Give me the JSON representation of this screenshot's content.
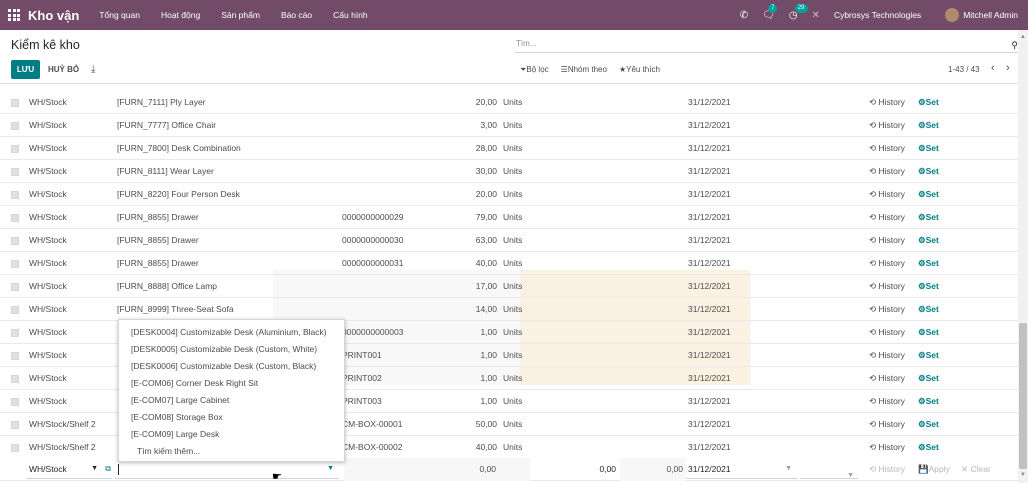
{
  "navbar": {
    "brand": "Kho vận",
    "menus": [
      "Tổng quan",
      "Hoạt động",
      "Sản phẩm",
      "Báo cáo",
      "Cấu hình"
    ],
    "chat_badge": "7",
    "activity_badge": "29",
    "company": "Cybrosys Technologies",
    "user": "Mitchell Admin"
  },
  "control": {
    "title": "Kiểm kê kho",
    "save_label": "LƯU",
    "discard_label": "HUỶ BỎ",
    "search_placeholder": "Tìm...",
    "filter_label": "Bộ lọc",
    "groupby_label": "Nhóm theo",
    "favorites_label": "Yêu thích",
    "pager": "1-43 / 43"
  },
  "rows": [
    {
      "location": "WH/Stock",
      "product": "[FURN_7111] Ply Layer",
      "lot": "",
      "qty": "20,00",
      "uom": "Units",
      "date": "31/12/2021",
      "history": "History",
      "set": "Set"
    },
    {
      "location": "WH/Stock",
      "product": "[FURN_7777] Office Chair",
      "lot": "",
      "qty": "3,00",
      "uom": "Units",
      "date": "31/12/2021",
      "history": "History",
      "set": "Set"
    },
    {
      "location": "WH/Stock",
      "product": "[FURN_7800] Desk Combination",
      "lot": "",
      "qty": "28,00",
      "uom": "Units",
      "date": "31/12/2021",
      "history": "History",
      "set": "Set"
    },
    {
      "location": "WH/Stock",
      "product": "[FURN_8111] Wear Layer",
      "lot": "",
      "qty": "30,00",
      "uom": "Units",
      "date": "31/12/2021",
      "history": "History",
      "set": "Set"
    },
    {
      "location": "WH/Stock",
      "product": "[FURN_8220] Four Person Desk",
      "lot": "",
      "qty": "20,00",
      "uom": "Units",
      "date": "31/12/2021",
      "history": "History",
      "set": "Set"
    },
    {
      "location": "WH/Stock",
      "product": "[FURN_8855] Drawer",
      "lot": "0000000000029",
      "qty": "79,00",
      "uom": "Units",
      "date": "31/12/2021",
      "history": "History",
      "set": "Set"
    },
    {
      "location": "WH/Stock",
      "product": "[FURN_8855] Drawer",
      "lot": "0000000000030",
      "qty": "63,00",
      "uom": "Units",
      "date": "31/12/2021",
      "history": "History",
      "set": "Set"
    },
    {
      "location": "WH/Stock",
      "product": "[FURN_8855] Drawer",
      "lot": "0000000000031",
      "qty": "40,00",
      "uom": "Units",
      "date": "31/12/2021",
      "history": "History",
      "set": "Set"
    },
    {
      "location": "WH/Stock",
      "product": "[FURN_8888] Office Lamp",
      "lot": "",
      "qty": "17,00",
      "uom": "Units",
      "date": "31/12/2021",
      "history": "History",
      "set": "Set"
    },
    {
      "location": "WH/Stock",
      "product": "[FURN_8999] Three-Seat Sofa",
      "lot": "",
      "qty": "14,00",
      "uom": "Units",
      "date": "31/12/2021",
      "history": "History",
      "set": "Set"
    },
    {
      "location": "WH/Stock",
      "product": "",
      "lot": "0000000000003",
      "qty": "1,00",
      "uom": "Units",
      "date": "31/12/2021",
      "history": "History",
      "set": "Set"
    },
    {
      "location": "WH/Stock",
      "product": "",
      "lot": "PRINT001",
      "qty": "1,00",
      "uom": "Units",
      "date": "31/12/2021",
      "history": "History",
      "set": "Set"
    },
    {
      "location": "WH/Stock",
      "product": "",
      "lot": "PRINT002",
      "qty": "1,00",
      "uom": "Units",
      "date": "31/12/2021",
      "history": "History",
      "set": "Set"
    },
    {
      "location": "WH/Stock",
      "product": "",
      "lot": "PRINT003",
      "qty": "1,00",
      "uom": "Units",
      "date": "31/12/2021",
      "history": "History",
      "set": "Set"
    },
    {
      "location": "WH/Stock/Shelf 2",
      "product": "",
      "lot": "CM-BOX-00001",
      "qty": "50,00",
      "uom": "Units",
      "date": "31/12/2021",
      "history": "History",
      "set": "Set"
    },
    {
      "location": "WH/Stock/Shelf 2",
      "product": "",
      "lot": "CM-BOX-00002",
      "qty": "40,00",
      "uom": "Units",
      "date": "31/12/2021",
      "history": "History",
      "set": "Set"
    }
  ],
  "edit_row": {
    "location": "WH/Stock",
    "on_hand": "0,00",
    "counted": "0,00",
    "difference": "0,00",
    "date": "31/12/2021",
    "history": "History",
    "apply": "Apply",
    "clear": "Clear"
  },
  "dropdown": {
    "items": [
      "[DESK0004] Customizable Desk (Aluminium, Black)",
      "[DESK0005] Customizable Desk (Custom, White)",
      "[DESK0006] Customizable Desk (Custom, Black)",
      "[E-COM06] Corner Desk Right Sit",
      "[E-COM07] Large Cabinet",
      "[E-COM08] Storage Box",
      "[E-COM09] Large Desk"
    ],
    "more": "Tìm kiếm thêm..."
  },
  "colors": {
    "navbar": "#714b67",
    "accent": "#017e84"
  }
}
